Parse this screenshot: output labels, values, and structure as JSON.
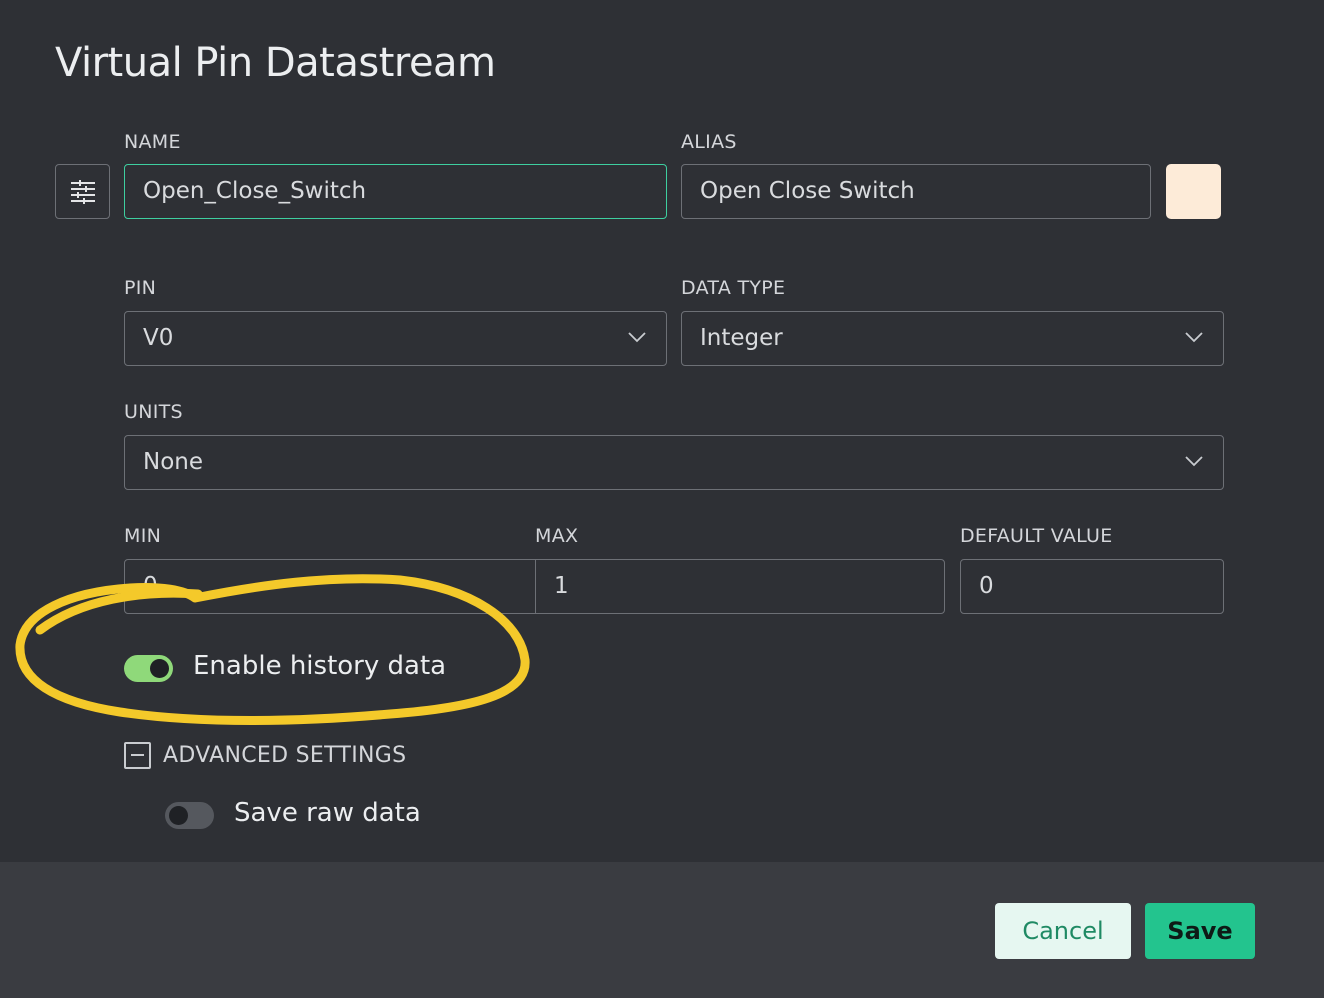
{
  "dialog": {
    "title": "Virtual Pin Datastream"
  },
  "name_field": {
    "label": "NAME",
    "value": "Open_Close_Switch"
  },
  "alias_field": {
    "label": "ALIAS",
    "value": "Open Close Switch"
  },
  "color_swatch": {
    "color": "#fdebd8"
  },
  "pin_field": {
    "label": "PIN",
    "value": "V0"
  },
  "datatype_field": {
    "label": "DATA TYPE",
    "value": "Integer"
  },
  "units_field": {
    "label": "UNITS",
    "value": "None"
  },
  "min_field": {
    "label": "MIN",
    "value": "0"
  },
  "max_field": {
    "label": "MAX",
    "value": "1"
  },
  "default_field": {
    "label": "DEFAULT VALUE",
    "value": "0"
  },
  "history_toggle": {
    "label": "Enable history data",
    "on": true
  },
  "advanced": {
    "label": "ADVANCED SETTINGS",
    "expanded": true
  },
  "raw_toggle": {
    "label": "Save raw data",
    "on": false
  },
  "footer": {
    "cancel_label": "Cancel",
    "save_label": "Save"
  },
  "colors": {
    "background": "#2e3035",
    "footer": "#3a3c41",
    "accent": "#23c48e",
    "focus_border": "#3ecfa0",
    "toggle_on": "#8fd97a",
    "toggle_off": "#55585e",
    "highlight_marker": "#f4c92a"
  }
}
